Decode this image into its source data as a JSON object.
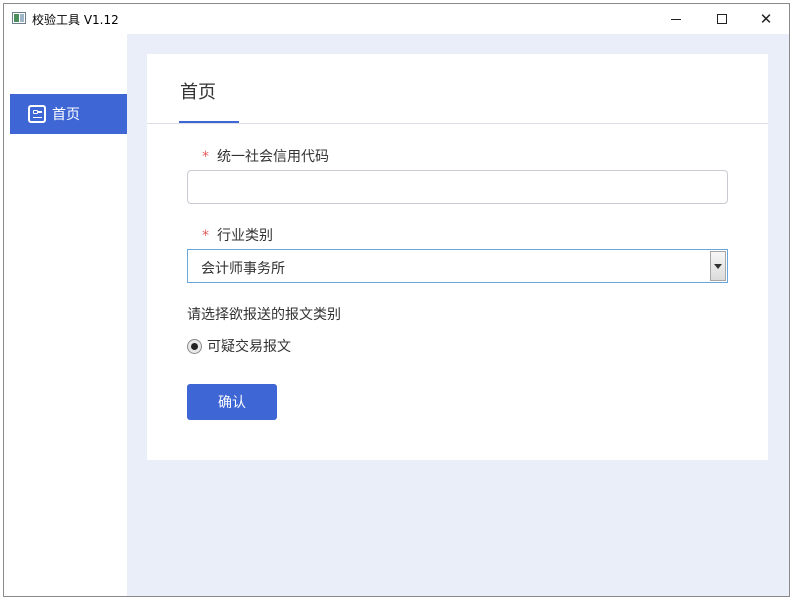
{
  "window": {
    "title": "校验工具 V1.12",
    "minimize_icon": "minimize-icon",
    "maximize_icon": "maximize-icon",
    "close_icon": "close-icon",
    "close_glyph": "✕"
  },
  "sidebar": {
    "items": [
      {
        "label": "首页",
        "icon": "home-card-icon",
        "active": true
      }
    ]
  },
  "main": {
    "tab_label": "首页",
    "form": {
      "credit_code": {
        "required_mark": "*",
        "label": "统一社会信用代码",
        "value": "",
        "placeholder": ""
      },
      "industry": {
        "required_mark": "*",
        "label": "行业类别",
        "selected": "会计师事务所"
      },
      "report_type": {
        "prompt": "请选择欲报送的报文类别",
        "options": [
          {
            "label": "可疑交易报文",
            "checked": true
          }
        ]
      },
      "confirm_label": "确认"
    }
  },
  "colors": {
    "accent": "#3e66d4",
    "content_bg": "#e9eef8",
    "required": "#e65a5a"
  }
}
